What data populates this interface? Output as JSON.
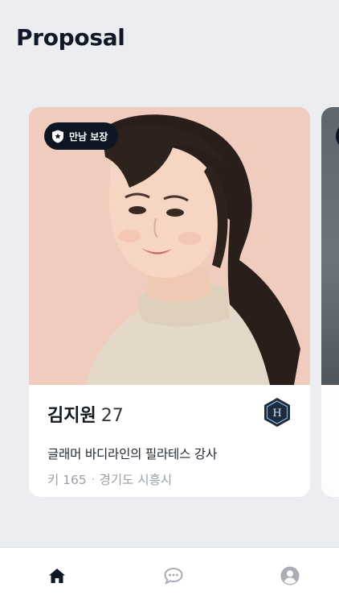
{
  "header": {
    "title": "Proposal"
  },
  "cards": [
    {
      "badge_label": "만남 보장",
      "name": "김지원",
      "age": "27",
      "intro": "글래머 바디라인의 필라테스 강사",
      "height": "키 165",
      "separator": "·",
      "location": "경기도 시흥시",
      "grade_letter": "H"
    }
  ],
  "nav": {
    "items": [
      {
        "icon": "home-icon",
        "active": true
      },
      {
        "icon": "chat-icon",
        "active": false
      },
      {
        "icon": "profile-icon",
        "active": false
      }
    ]
  },
  "colors": {
    "background": "#ebedf0",
    "badge_dark": "#0e1624",
    "photo_bg": "#f0ccbf",
    "text_muted": "#9aa0a8",
    "nav_inactive": "#a9aeb6"
  }
}
